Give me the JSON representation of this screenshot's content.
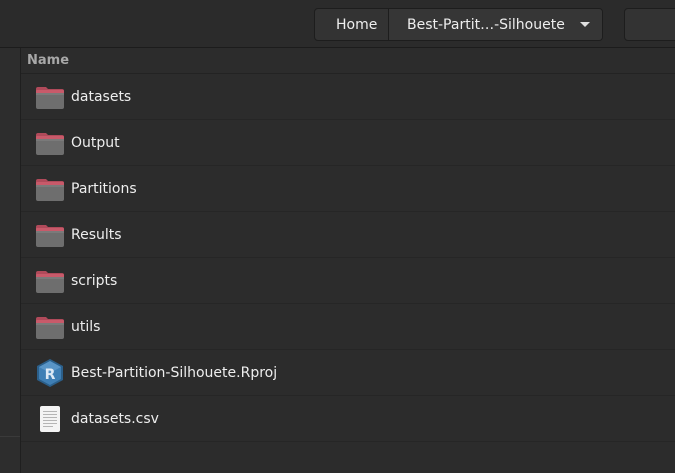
{
  "pathbar": {
    "home_label": "Home",
    "current_label": "Best-Partit…-Silhouete"
  },
  "list": {
    "column_header": "Name",
    "items": [
      {
        "name": "datasets",
        "icon": "folder-icon"
      },
      {
        "name": "Output",
        "icon": "folder-icon"
      },
      {
        "name": "Partitions",
        "icon": "folder-icon"
      },
      {
        "name": "Results",
        "icon": "folder-icon"
      },
      {
        "name": "scripts",
        "icon": "folder-icon"
      },
      {
        "name": "utils",
        "icon": "folder-icon"
      },
      {
        "name": "Best-Partition-Silhouete.Rproj",
        "icon": "rproj-file-icon"
      },
      {
        "name": "datasets.csv",
        "icon": "text-file-icon"
      }
    ]
  },
  "colors": {
    "background": "#2c2c2c",
    "folder_tab": "#b04a5a",
    "folder_body": "#6b6b6b",
    "text": "#eeeeee"
  }
}
